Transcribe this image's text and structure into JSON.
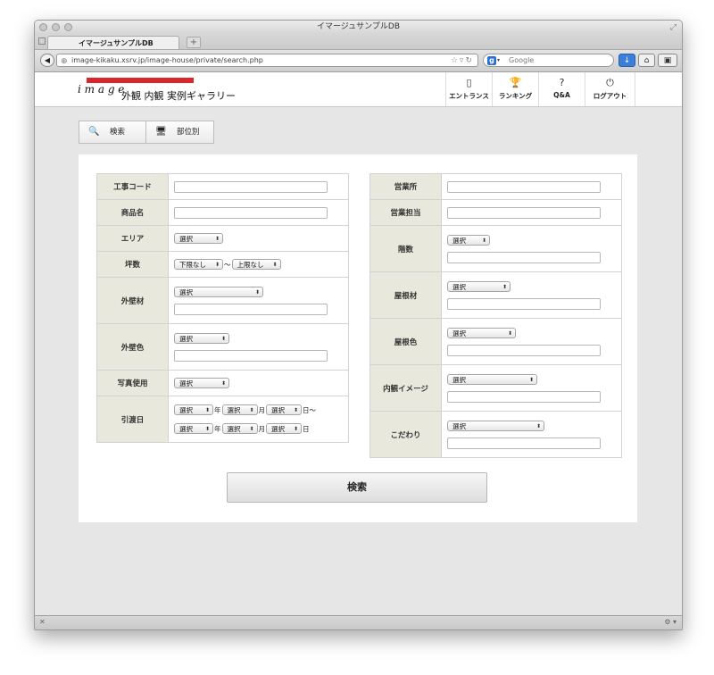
{
  "window": {
    "title": "イマージュサンプルDB"
  },
  "browser": {
    "tab_title": "イマージュサンプルDB",
    "new_tab": "+",
    "url": "image-kikaku.xsrv.jp/image-house/private/search.php",
    "search_placeholder": "Google"
  },
  "site": {
    "logo_mark": "i m a g e",
    "logo_title": "外観 内観 実例ギャラリー",
    "nav": [
      {
        "label": "エントランス",
        "icon": "building-icon",
        "glyph": "▯"
      },
      {
        "label": "ランキング",
        "icon": "trophy-icon",
        "glyph": "🏆"
      },
      {
        "label": "Q&A",
        "icon": "question-icon",
        "glyph": "?"
      },
      {
        "label": "ログアウト",
        "icon": "power-icon",
        "glyph": "⏻"
      }
    ]
  },
  "search_tabs": [
    {
      "label": "検索",
      "icon": "search-icon",
      "glyph": "🔍"
    },
    {
      "label": "部位別",
      "icon": "monitor-icon",
      "glyph": "🖥"
    }
  ],
  "form": {
    "select_default": "選択",
    "left": {
      "construction_code": "工事コード",
      "product_name": "商品名",
      "area": "エリア",
      "tsubo": "坪数",
      "tsubo_min": "下限なし",
      "tsubo_sep": "〜",
      "tsubo_max": "上限なし",
      "exterior_material": "外壁材",
      "exterior_color": "外壁色",
      "photo_use": "写真使用",
      "delivery_date": "引渡日",
      "year": "年",
      "month": "月",
      "day_from": "日〜",
      "day": "日"
    },
    "right": {
      "office": "営業所",
      "sales_rep": "営業担当",
      "floors": "階数",
      "roof_material": "屋根材",
      "roof_color": "屋根色",
      "interior_image": "内観イメージ",
      "preference": "こだわり"
    },
    "submit": "検索"
  }
}
